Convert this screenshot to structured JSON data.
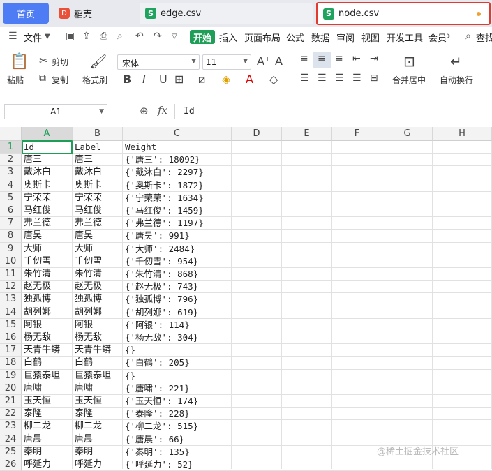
{
  "tabs": [
    {
      "label": "首页"
    },
    {
      "label": "稻壳",
      "icon_text": "D"
    },
    {
      "label": "edge.csv",
      "icon_text": "S"
    },
    {
      "label": "node.csv",
      "icon_text": "S"
    }
  ],
  "menu": {
    "file": "文件",
    "start": "开始",
    "items": [
      "插入",
      "页面布局",
      "公式",
      "数据",
      "审阅",
      "视图",
      "开发工具",
      "会员"
    ],
    "search": "查找"
  },
  "ribbon": {
    "paste": "粘贴",
    "cut": "剪切",
    "copy": "复制",
    "format_painter": "格式刷",
    "font_name": "宋体",
    "font_size": "11",
    "merge": "合并居中",
    "wrap": "自动换行"
  },
  "formula": {
    "cell_ref": "A1",
    "fx": "fx",
    "content": "Id"
  },
  "columns": [
    "A",
    "B",
    "C",
    "D",
    "E",
    "F",
    "G",
    "H"
  ],
  "rows": [
    [
      "Id",
      "Label",
      "Weight"
    ],
    [
      "唐三",
      "唐三",
      "{'唐三': 18092}"
    ],
    [
      "戴沐白",
      "戴沐白",
      "{'戴沐白': 2297}"
    ],
    [
      "奥斯卡",
      "奥斯卡",
      "{'奥斯卡': 1872}"
    ],
    [
      "宁荣荣",
      "宁荣荣",
      "{'宁荣荣': 1634}"
    ],
    [
      "马红俊",
      "马红俊",
      "{'马红俊': 1459}"
    ],
    [
      "弗兰德",
      "弗兰德",
      "{'弗兰德': 1197}"
    ],
    [
      "唐昊",
      "唐昊",
      "{'唐昊': 991}"
    ],
    [
      "大师",
      "大师",
      "{'大师': 2484}"
    ],
    [
      "千仞雪",
      "千仞雪",
      "{'千仞雪': 954}"
    ],
    [
      "朱竹清",
      "朱竹清",
      "{'朱竹清': 868}"
    ],
    [
      "赵无极",
      "赵无极",
      "{'赵无极': 743}"
    ],
    [
      "独孤博",
      "独孤博",
      "{'独孤博': 796}"
    ],
    [
      "胡列娜",
      "胡列娜",
      "{'胡列娜': 619}"
    ],
    [
      "阿银",
      "阿银",
      "{'阿银': 114}"
    ],
    [
      "杨无敌",
      "杨无敌",
      "{'杨无敌': 304}"
    ],
    [
      "天青牛蟒",
      "天青牛蟒",
      "{}"
    ],
    [
      "白鹤",
      "白鹤",
      "{'白鹤': 205}"
    ],
    [
      "巨猿泰坦",
      "巨猿泰坦",
      "{}"
    ],
    [
      "唐啸",
      "唐啸",
      "{'唐啸': 221}"
    ],
    [
      "玉天恒",
      "玉天恒",
      "{'玉天恒': 174}"
    ],
    [
      "泰隆",
      "泰隆",
      "{'泰隆': 228}"
    ],
    [
      "柳二龙",
      "柳二龙",
      "{'柳二龙': 515}"
    ],
    [
      "唐晨",
      "唐晨",
      "{'唐晨': 66}"
    ],
    [
      "秦明",
      "秦明",
      "{'秦明': 135}"
    ],
    [
      "呼延力",
      "呼延力",
      "{'呼延力': 52}"
    ]
  ],
  "watermark": "@稀土掘金技术社区",
  "colors": {
    "accent": "#1e9e56",
    "home_tab": "#4d7cf4",
    "highlight_box": "#e33a30"
  }
}
